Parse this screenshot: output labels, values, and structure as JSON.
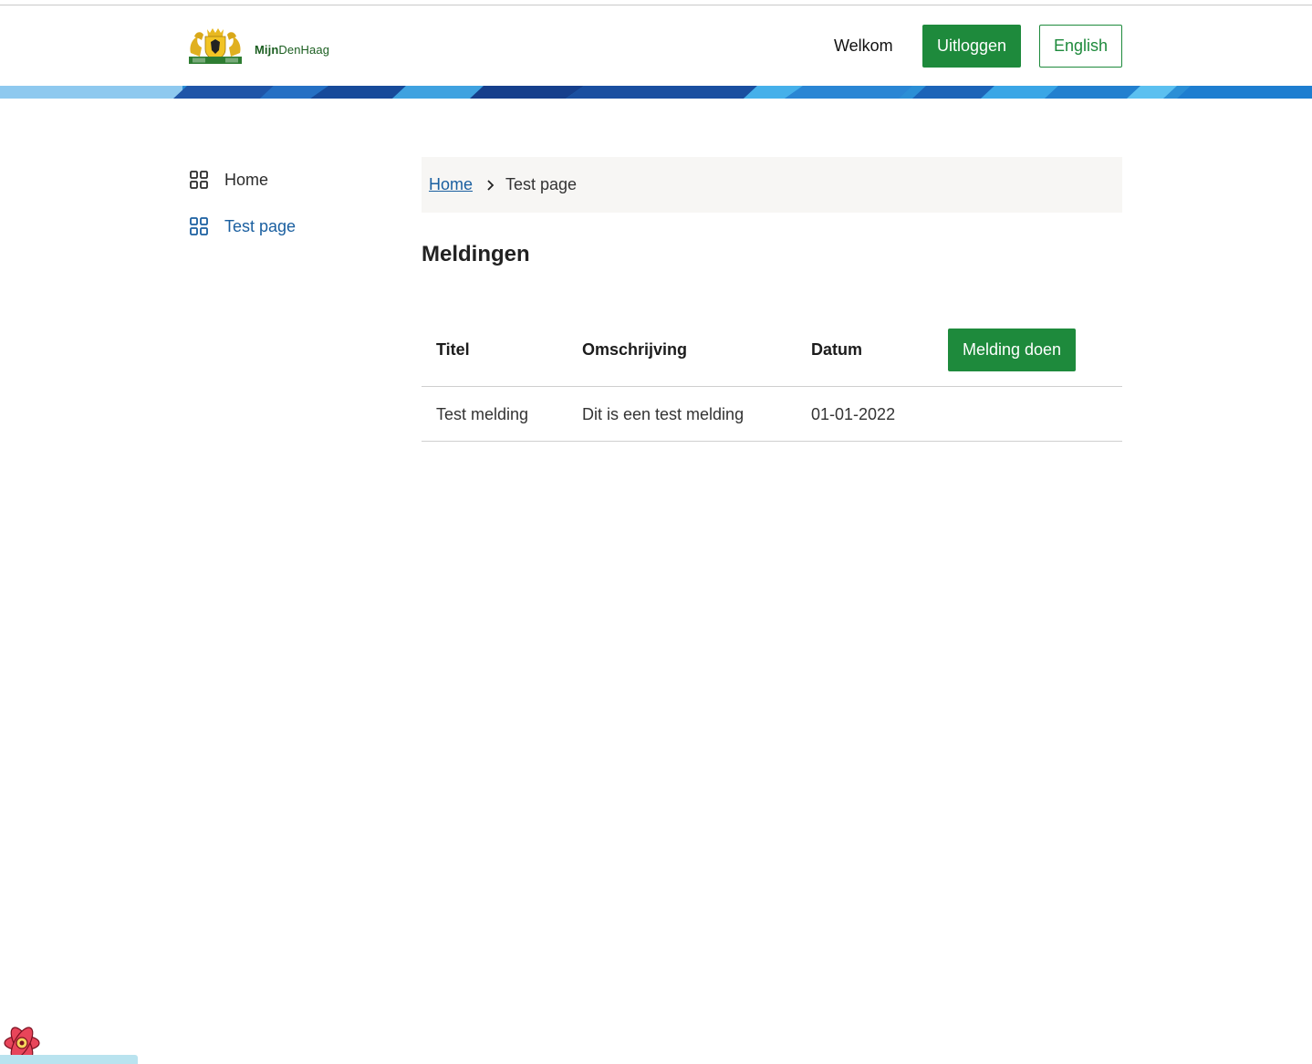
{
  "header": {
    "logo_text_bold": "Mijn",
    "logo_text_regular": "DenHaag",
    "welcome": "Welkom",
    "logout_label": "Uitloggen",
    "language_label": "English"
  },
  "sidebar": {
    "items": [
      {
        "label": "Home",
        "icon": "grid-icon",
        "active": false
      },
      {
        "label": "Test page",
        "icon": "grid-icon",
        "active": true
      }
    ]
  },
  "breadcrumb": {
    "home": "Home",
    "current": "Test page"
  },
  "main": {
    "title": "Meldingen",
    "table": {
      "columns": [
        "Titel",
        "Omschrijving",
        "Datum"
      ],
      "action_label": "Melding doen",
      "rows": [
        {
          "titel": "Test melding",
          "omschrijving": "Dit is een test melding",
          "datum": "01-01-2022"
        }
      ]
    }
  },
  "colors": {
    "primary_green": "#1e8a3c",
    "link_blue": "#1a5fa0"
  }
}
